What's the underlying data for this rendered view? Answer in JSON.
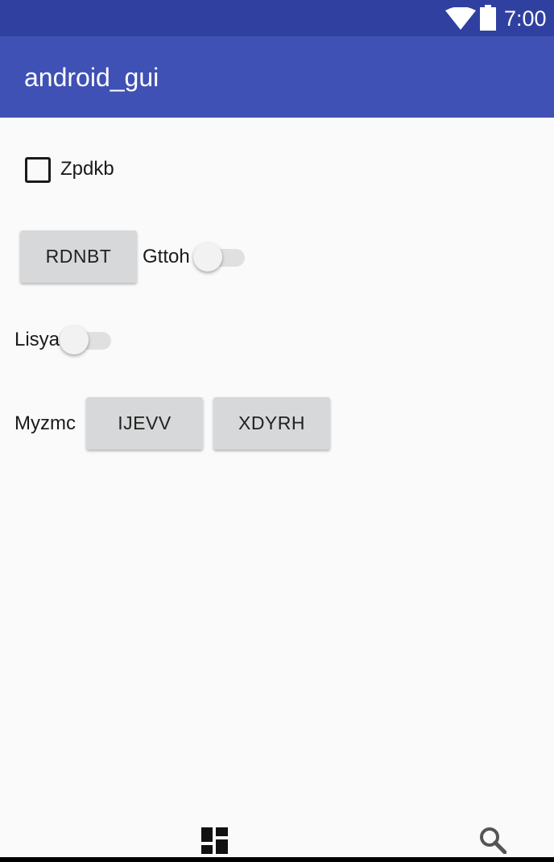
{
  "status_bar": {
    "time": "7:00",
    "wifi_icon": "wifi-icon",
    "battery_icon": "battery-icon",
    "color": "#3040a0"
  },
  "app_bar": {
    "title": "android_gui",
    "color": "#3f51b5"
  },
  "content": {
    "checkbox": {
      "label": "Zpdkb",
      "checked": false
    },
    "row2": {
      "button_label": "RDNBT",
      "switch_label": "Gttoh",
      "switch_on": false
    },
    "row3": {
      "switch_label": "Lisya",
      "switch_on": false
    },
    "row4": {
      "label": "Myzmc",
      "button1_label": "IJEVV",
      "button2_label": "XDYRH"
    }
  },
  "bottom_nav": {
    "left_icon": "grid-icon",
    "right_icon": "search-icon"
  }
}
